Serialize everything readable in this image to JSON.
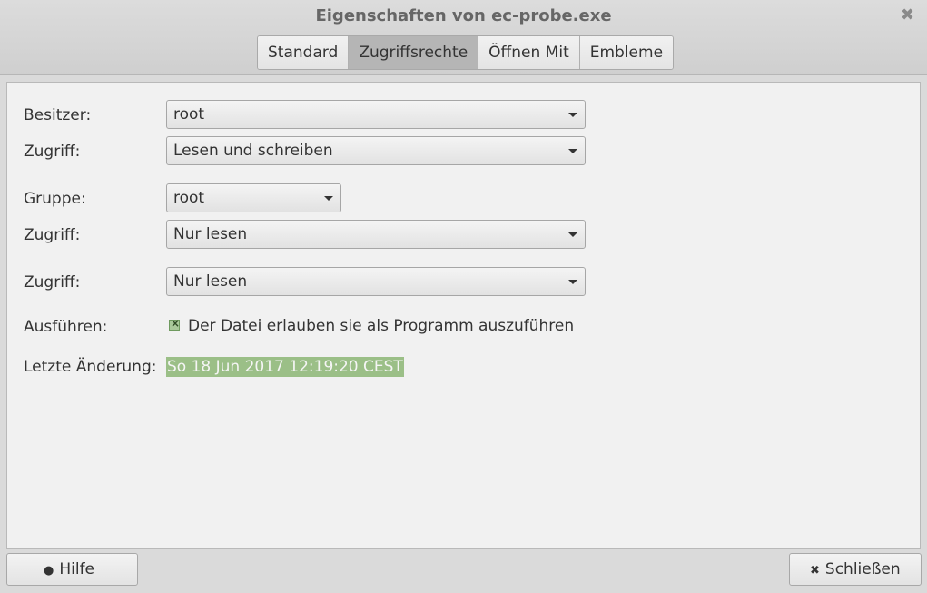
{
  "window": {
    "title": "Eigenschaften von ec-probe.exe",
    "close_glyph": "✖"
  },
  "tabs": [
    {
      "label": "Standard",
      "active": false
    },
    {
      "label": "Zugriffsrechte",
      "active": true
    },
    {
      "label": "Öffnen Mit",
      "active": false
    },
    {
      "label": "Embleme",
      "active": false
    }
  ],
  "owner": {
    "label": "Besitzer:",
    "value": "root",
    "access_label": "Zugriff:",
    "access_value": "Lesen und schreiben"
  },
  "group": {
    "label": "Gruppe:",
    "value": "root",
    "access_label": "Zugriff:",
    "access_value": "Nur lesen"
  },
  "others": {
    "access_label": "Zugriff:",
    "access_value": "Nur lesen"
  },
  "execute": {
    "label": "Ausführen:",
    "checkbox_label": "Der Datei erlauben sie als Programm auszuführen",
    "checked": true
  },
  "modified": {
    "label": "Letzte Änderung:",
    "value": "So 18 Jun 2017 12:19:20 CEST"
  },
  "buttons": {
    "help": "Hilfe",
    "close": "Schließen"
  },
  "colors": {
    "selection": "#9bbf87",
    "active_tab": "#b5b5b5"
  }
}
